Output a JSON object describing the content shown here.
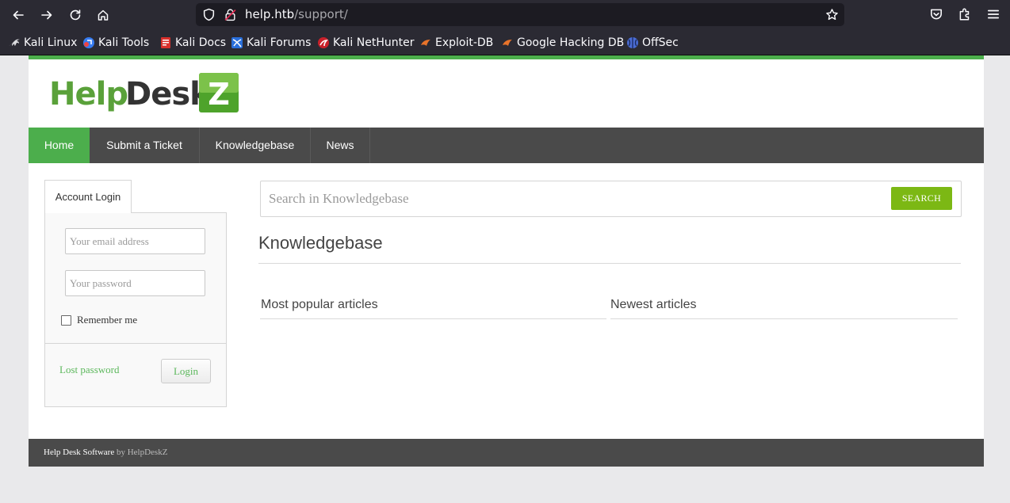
{
  "browser": {
    "url_host": "help.htb",
    "url_path": "/support/",
    "bookmarks": [
      {
        "label": "Kali Linux",
        "icon": "kali-dragon-icon"
      },
      {
        "label": "Kali Tools",
        "icon": "kali-tools-icon"
      },
      {
        "label": "Kali Docs",
        "icon": "kali-docs-icon"
      },
      {
        "label": "Kali Forums",
        "icon": "kali-forums-icon"
      },
      {
        "label": "Kali NetHunter",
        "icon": "nethunter-icon"
      },
      {
        "label": "Exploit-DB",
        "icon": "exploit-db-icon"
      },
      {
        "label": "Google Hacking DB",
        "icon": "ghdb-icon"
      },
      {
        "label": "OffSec",
        "icon": "offsec-icon"
      }
    ]
  },
  "site": {
    "logo_text": "HelpDeskZ",
    "nav": [
      {
        "label": "Home",
        "active": true
      },
      {
        "label": "Submit a Ticket",
        "active": false
      },
      {
        "label": "Knowledgebase",
        "active": false
      },
      {
        "label": "News",
        "active": false
      }
    ],
    "login": {
      "tab_label": "Account Login",
      "email_placeholder": "Your email address",
      "password_placeholder": "Your password",
      "remember_label": "Remember me",
      "lost_password_label": "Lost password",
      "login_button_label": "Login"
    },
    "search": {
      "placeholder": "Search in Knowledgebase",
      "button_label": "SEARCH"
    },
    "kb_title": "Knowledgebase",
    "popular_title": "Most popular articles",
    "newest_title": "Newest articles",
    "footer": {
      "software": "Help Desk Software",
      "by": "by HelpDeskZ"
    }
  },
  "colors": {
    "accent_green": "#4cae4c",
    "search_green": "#7cb814",
    "nav_dark": "#4a4a4a"
  }
}
